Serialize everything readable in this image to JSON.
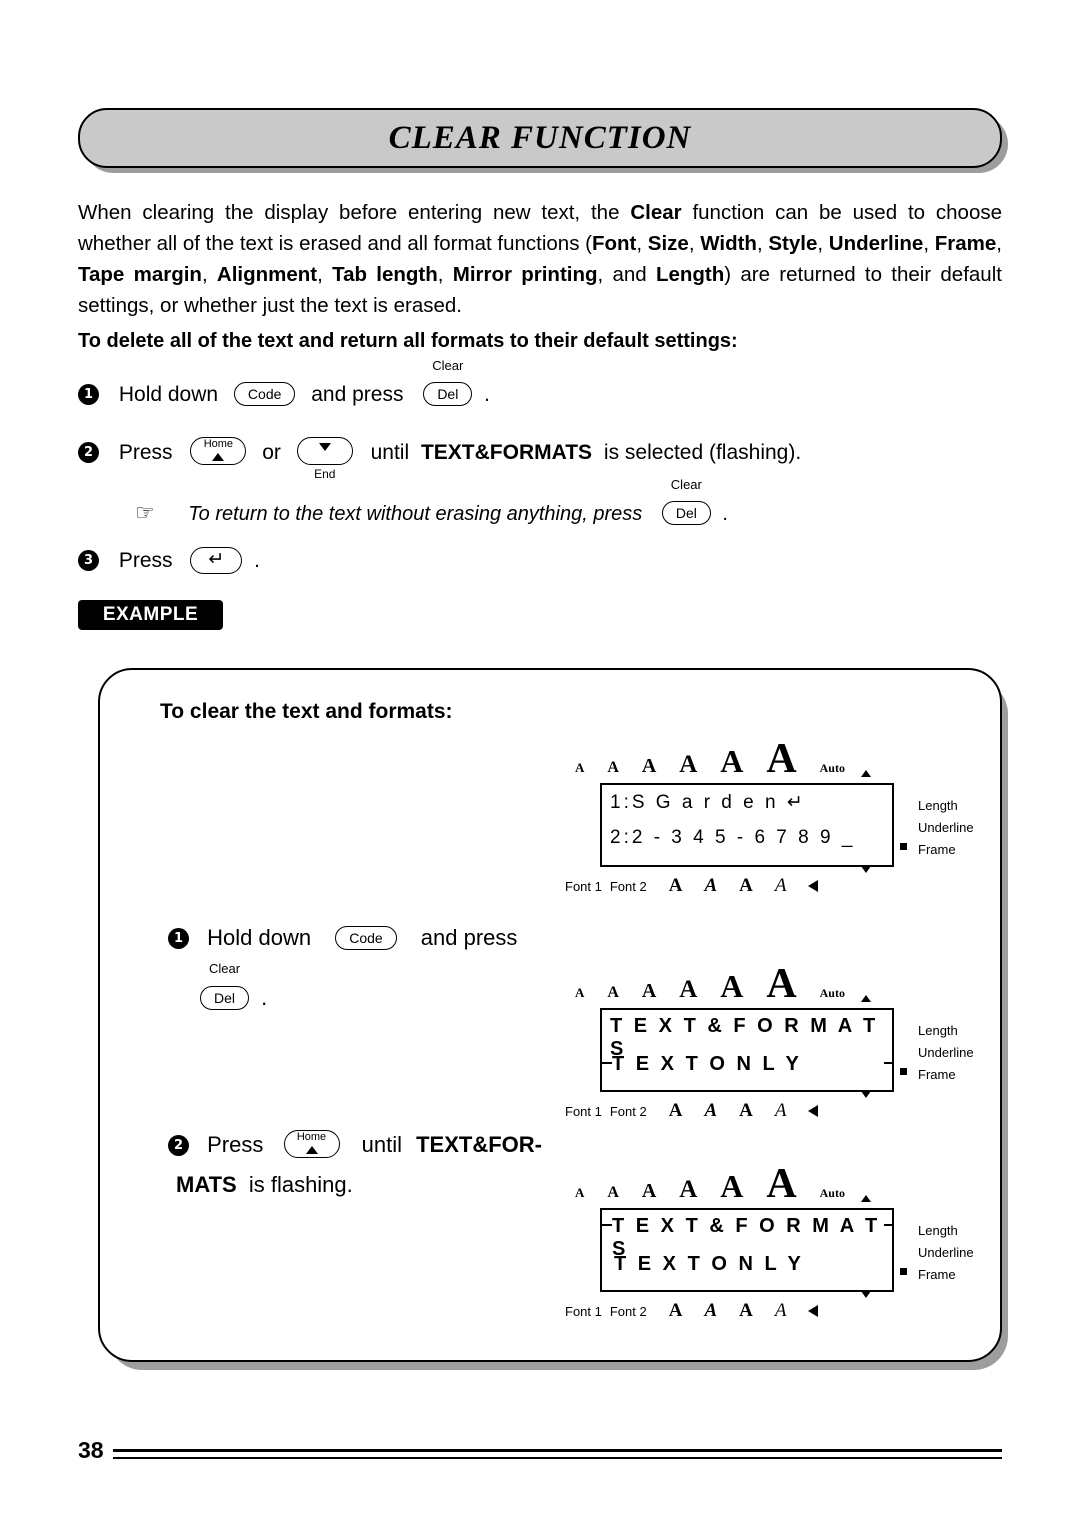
{
  "title": "CLEAR FUNCTION",
  "intro": {
    "text_parts": [
      {
        "t": "When clearing the display before entering new text, the ",
        "b": false
      },
      {
        "t": "Clear",
        "b": true
      },
      {
        "t": " function can be used to choose whether all of the text is erased and all format functions (",
        "b": false
      },
      {
        "t": "Font",
        "b": true
      },
      {
        "t": ", ",
        "b": false
      },
      {
        "t": "Size",
        "b": true
      },
      {
        "t": ", ",
        "b": false
      },
      {
        "t": "Width",
        "b": true
      },
      {
        "t": ", ",
        "b": false
      },
      {
        "t": "Style",
        "b": true
      },
      {
        "t": ", ",
        "b": false
      },
      {
        "t": "Underline",
        "b": true
      },
      {
        "t": ", ",
        "b": false
      },
      {
        "t": "Frame",
        "b": true
      },
      {
        "t": ", ",
        "b": false
      },
      {
        "t": "Tape margin",
        "b": true
      },
      {
        "t": ", ",
        "b": false
      },
      {
        "t": "Alignment",
        "b": true
      },
      {
        "t": ", ",
        "b": false
      },
      {
        "t": "Tab length",
        "b": true
      },
      {
        "t": ", ",
        "b": false
      },
      {
        "t": "Mirror printing",
        "b": true
      },
      {
        "t": ", and ",
        "b": false
      },
      {
        "t": "Length",
        "b": true
      },
      {
        "t": ") are returned to their default settings, or whether just the text is erased.",
        "b": false
      }
    ]
  },
  "subhead": "To delete all of the text and return all formats to their default settings:",
  "steps": {
    "one": {
      "num": "1",
      "pre": "Hold down",
      "key1": "Code",
      "mid": "and press",
      "key2_top": "Clear",
      "key2": "Del",
      "post": "."
    },
    "two": {
      "num": "2",
      "pre": "Press",
      "key_home_top": "Home",
      "or": "or",
      "key_end_bot": "End",
      "mid": "until",
      "bold": "TEXT&FORMATS",
      "post": "is selected (flashing)."
    },
    "note": {
      "hand": "☞",
      "text": "To return to the text without erasing anything, press",
      "key_top": "Clear",
      "key": "Del",
      "post": "."
    },
    "three": {
      "num": "3",
      "pre": "Press",
      "key": "↵",
      "post": "."
    }
  },
  "example_tag": "EXAMPLE",
  "example": {
    "title": "To clear the text and formats:",
    "step1": {
      "num": "1",
      "pre": "Hold  down",
      "key1": "Code",
      "mid": "and  press",
      "key2_top": "Clear",
      "key2": "Del",
      "post": "."
    },
    "step2": {
      "num": "2",
      "pre": "Press",
      "key_home_top": "Home",
      "mid": "until",
      "bold1": "TEXT&FOR-",
      "bold2": "MATS",
      "post": "is flashing."
    }
  },
  "lcds": [
    {
      "id": "lcd-1",
      "top_icons": [
        "A",
        "A",
        "A",
        "A",
        "A",
        "A"
      ],
      "auto": "Auto",
      "line1": "1:S  G a r d e n ↵",
      "line2": "2:2 - 3 4 5 - 6 7 8 9 _",
      "right_labels": [
        "Length",
        "Underline",
        "Frame"
      ],
      "bottom_left": [
        "Font 1",
        "Font 2"
      ],
      "bottom_icons": [
        "A",
        "A",
        "A",
        "A"
      ]
    },
    {
      "id": "lcd-2",
      "top_icons": [
        "A",
        "A",
        "A",
        "A",
        "A",
        "A"
      ],
      "auto": "Auto",
      "line1": "T E X T & F O R M A T S",
      "line2": "T E X T   O N L Y",
      "right_labels": [
        "Length",
        "Underline",
        "Frame"
      ],
      "bottom_left": [
        "Font 1",
        "Font 2"
      ],
      "bottom_icons": [
        "A",
        "A",
        "A",
        "A"
      ]
    },
    {
      "id": "lcd-3",
      "top_icons": [
        "A",
        "A",
        "A",
        "A",
        "A",
        "A"
      ],
      "auto": "Auto",
      "line1": "T E X T & F O R M A T S",
      "line2": "T E X T   O N L Y",
      "right_labels": [
        "Length",
        "Underline",
        "Frame"
      ],
      "bottom_left": [
        "Font 1",
        "Font 2"
      ],
      "bottom_icons": [
        "A",
        "A",
        "A",
        "A"
      ]
    }
  ],
  "footer": {
    "page": "38"
  }
}
